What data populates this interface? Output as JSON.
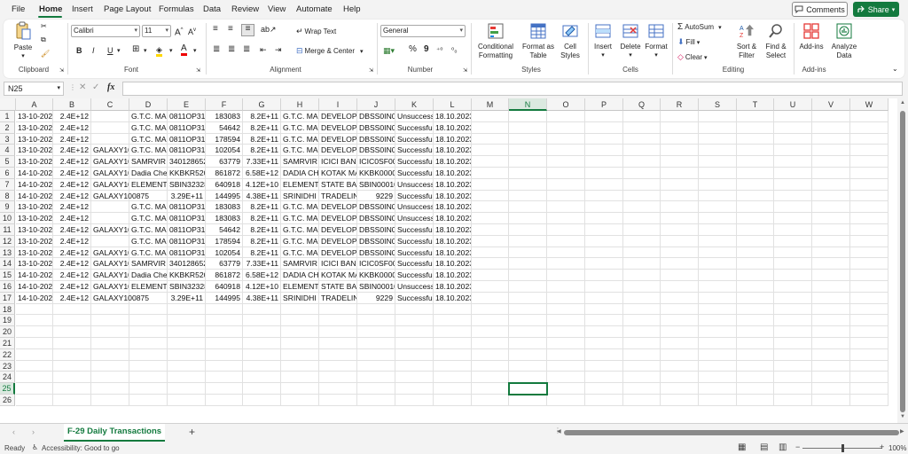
{
  "menu": {
    "tabs": [
      "File",
      "Home",
      "Insert",
      "Page Layout",
      "Formulas",
      "Data",
      "Review",
      "View",
      "Automate",
      "Help"
    ],
    "active": "Home",
    "comments_label": "Comments",
    "share_label": "Share"
  },
  "ribbon": {
    "clipboard": {
      "group": "Clipboard",
      "paste": "Paste"
    },
    "font": {
      "group": "Font",
      "font_name": "Calibri",
      "font_size": "11",
      "bold": "B",
      "italic": "I",
      "underline": "U"
    },
    "alignment": {
      "group": "Alignment",
      "wrap_text": "Wrap Text",
      "merge_center": "Merge & Center"
    },
    "number": {
      "group": "Number",
      "format": "General",
      "percent": "%",
      "comma": "9"
    },
    "styles": {
      "group": "Styles",
      "conditional": "Conditional Formatting",
      "format_table": "Format as Table",
      "cell_styles": "Cell Styles"
    },
    "cells": {
      "group": "Cells",
      "insert": "Insert",
      "delete": "Delete",
      "format": "Format"
    },
    "editing": {
      "group": "Editing",
      "autosum": "AutoSum",
      "fill": "Fill",
      "clear": "Clear",
      "sort_filter": "Sort & Filter",
      "find_select": "Find & Select"
    },
    "addins": {
      "group": "Add-ins",
      "addins": "Add-ins",
      "analyze": "Analyze Data"
    }
  },
  "formula_bar": {
    "name_box": "N25",
    "fx": "fx",
    "value": ""
  },
  "grid": {
    "columns": [
      "A",
      "B",
      "C",
      "D",
      "E",
      "F",
      "G",
      "H",
      "I",
      "J",
      "K",
      "L",
      "M",
      "N",
      "O",
      "P",
      "Q",
      "R",
      "S",
      "T",
      "U",
      "V",
      "W"
    ],
    "selected_column": "N",
    "selected_row": 25,
    "row_count": 26,
    "rows": [
      [
        "13-10-202",
        "2.4E+12",
        "",
        "G.T.C. MA",
        "0811OP31",
        "183083",
        "8.2E+11",
        "G.T.C. MA",
        "DEVELOPM",
        "DBSS0IN0",
        "Unsuccess",
        "18.10.2023"
      ],
      [
        "13-10-202",
        "2.4E+12",
        "",
        "G.T.C. MA",
        "0811OP31",
        "54642",
        "8.2E+11",
        "G.T.C. MA",
        "DEVELOPM",
        "DBSS0IN0",
        "Successful",
        "18.10.2023"
      ],
      [
        "13-10-202",
        "2.4E+12",
        "",
        "G.T.C. MA",
        "0811OP31",
        "178594",
        "8.2E+11",
        "G.T.C. MA",
        "DEVELOPM",
        "DBSS0IN0",
        "Successful",
        "18.10.2023"
      ],
      [
        "13-10-202",
        "2.4E+12",
        "GALAXY10",
        "G.T.C. MA",
        "0811OP31",
        "102054",
        "8.2E+11",
        "G.T.C. MA",
        "DEVELOPM",
        "DBSS0IN0",
        "Successful",
        "18.10.2023"
      ],
      [
        "13-10-202",
        "2.4E+12",
        "GALAXY10",
        "SAMRVIR I",
        "340128652",
        "63779",
        "7.33E+11",
        "SAMRVIR I",
        "ICICI BANK",
        "ICIC0SF00",
        "Successful",
        "18.10.2023"
      ],
      [
        "14-10-202",
        "2.4E+12",
        "GALAXY10",
        "Dadia Che",
        "KKBKR520",
        "861872",
        "6.58E+12",
        "DADIA CHE",
        "KOTAK MA",
        "KKBK0000",
        "Successful",
        "18.10.2023"
      ],
      [
        "14-10-202",
        "2.4E+12",
        "GALAXY10",
        "ELEMENT",
        "SBIN32328",
        "640918",
        "4.12E+10",
        "ELEMENT",
        "STATE BAN",
        "SBIN00010",
        "Unsuccess",
        "18.10.2023"
      ],
      [
        "14-10-202",
        "2.4E+12",
        "GALAXY100875",
        "",
        "3.29E+11",
        "144995",
        "4.38E+11",
        "SRINIDHI",
        "TRADELINK",
        "9229",
        "Successful",
        "18.10.2023"
      ],
      [
        "13-10-202",
        "2.4E+12",
        "",
        "G.T.C. MA",
        "0811OP31",
        "183083",
        "8.2E+11",
        "G.T.C. MA",
        "DEVELOPM",
        "DBSS0IN0",
        "Unsuccess",
        "18.10.2023"
      ],
      [
        "13-10-202",
        "2.4E+12",
        "",
        "G.T.C. MA",
        "0811OP31",
        "183083",
        "8.2E+11",
        "G.T.C. MA",
        "DEVELOPM",
        "DBSS0IN0",
        "Unsuccess",
        "18.10.2023"
      ],
      [
        "13-10-202",
        "2.4E+12",
        "GALAXY10",
        "G.T.C. MA",
        "0811OP31",
        "54642",
        "8.2E+11",
        "G.T.C. MA",
        "DEVELOPM",
        "DBSS0IN0",
        "Successful",
        "18.10.2023"
      ],
      [
        "13-10-202",
        "2.4E+12",
        "",
        "G.T.C. MA",
        "0811OP31",
        "178594",
        "8.2E+11",
        "G.T.C. MA",
        "DEVELOPM",
        "DBSS0IN0",
        "Successful",
        "18.10.2023"
      ],
      [
        "13-10-202",
        "2.4E+12",
        "GALAXY10",
        "G.T.C. MA",
        "0811OP31",
        "102054",
        "8.2E+11",
        "G.T.C. MA",
        "DEVELOPM",
        "DBSS0IN0",
        "Successful",
        "18.10.2023"
      ],
      [
        "13-10-202",
        "2.4E+12",
        "GALAXY10",
        "SAMRVIR I",
        "340128652",
        "63779",
        "7.33E+11",
        "SAMRVIR I",
        "ICICI BANK",
        "ICIC0SF00",
        "Successful",
        "18.10.2023"
      ],
      [
        "14-10-202",
        "2.4E+12",
        "GALAXY10",
        "Dadia Che",
        "KKBKR520",
        "861872",
        "6.58E+12",
        "DADIA CHE",
        "KOTAK MA",
        "KKBK0000",
        "Successful",
        "18.10.2023"
      ],
      [
        "14-10-202",
        "2.4E+12",
        "GALAXY10",
        "ELEMENT",
        "SBIN32328",
        "640918",
        "4.12E+10",
        "ELEMENT",
        "STATE BAN",
        "SBIN00010",
        "Unsuccess",
        "18.10.2023"
      ],
      [
        "14-10-202",
        "2.4E+12",
        "GALAXY100875",
        "",
        "3.29E+11",
        "144995",
        "4.38E+11",
        "SRINIDHI",
        "TRADELINK",
        "9229",
        "Successful",
        "18.10.2023"
      ]
    ]
  },
  "sheet_tabs": {
    "active": "F-29 Daily Transactions",
    "add": "+"
  },
  "status": {
    "ready": "Ready",
    "accessibility": "Accessibility: Good to go",
    "zoom": "100%"
  }
}
